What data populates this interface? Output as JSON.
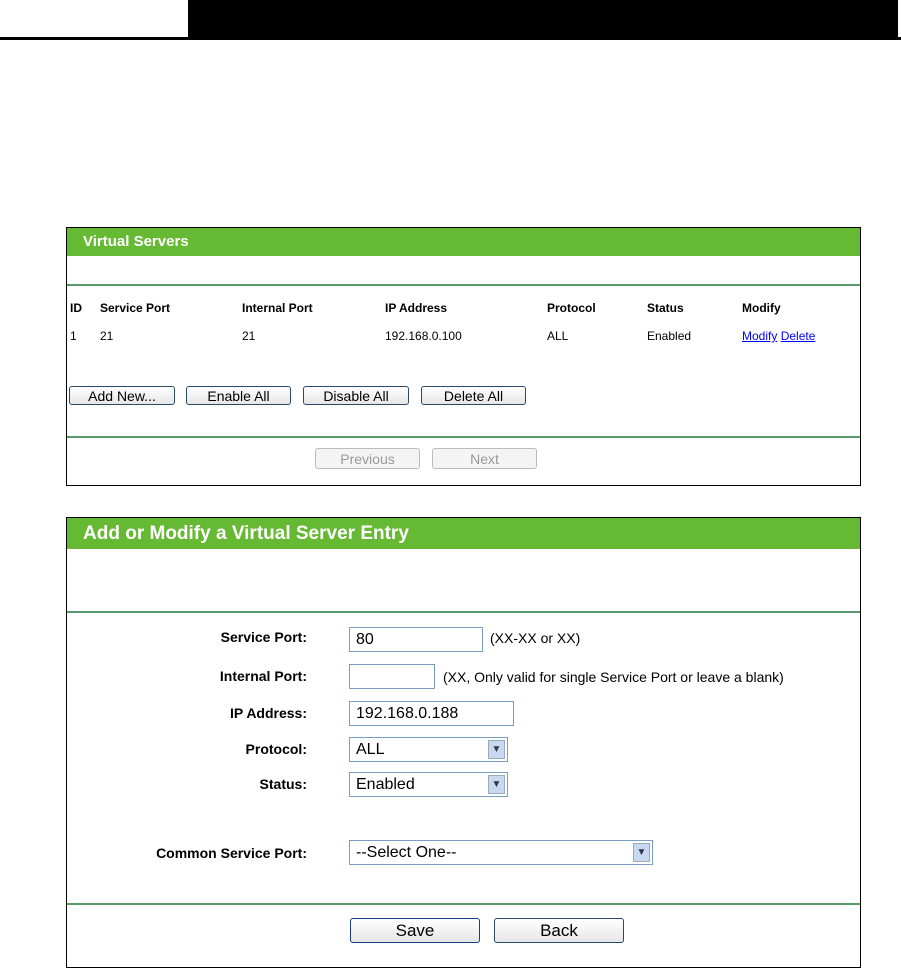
{
  "virtual_servers": {
    "title": "Virtual Servers",
    "columns": [
      "ID",
      "Service Port",
      "Internal Port",
      "IP Address",
      "Protocol",
      "Status",
      "Modify"
    ],
    "rows": [
      {
        "id": "1",
        "service_port": "21",
        "internal_port": "21",
        "ip": "192.168.0.100",
        "protocol": "ALL",
        "status": "Enabled",
        "modify": "Modify",
        "delete": "Delete"
      }
    ],
    "buttons": {
      "add_new": "Add New...",
      "enable_all": "Enable All",
      "disable_all": "Disable All",
      "delete_all": "Delete All",
      "previous": "Previous",
      "next": "Next"
    }
  },
  "entry": {
    "title": "Add or Modify a Virtual Server Entry",
    "service_port_label": "Service Port:",
    "service_port_value": "80",
    "service_port_hint": "(XX-XX or XX)",
    "internal_port_label": "Internal Port:",
    "internal_port_value": "",
    "internal_port_hint": "(XX, Only valid for single Service Port or leave a blank)",
    "ip_label": "IP Address:",
    "ip_value": "192.168.0.188",
    "protocol_label": "Protocol:",
    "protocol_value": "ALL",
    "status_label": "Status:",
    "status_value": "Enabled",
    "common_label": "Common Service Port:",
    "common_value": "--Select One--",
    "save": "Save",
    "back": "Back"
  }
}
